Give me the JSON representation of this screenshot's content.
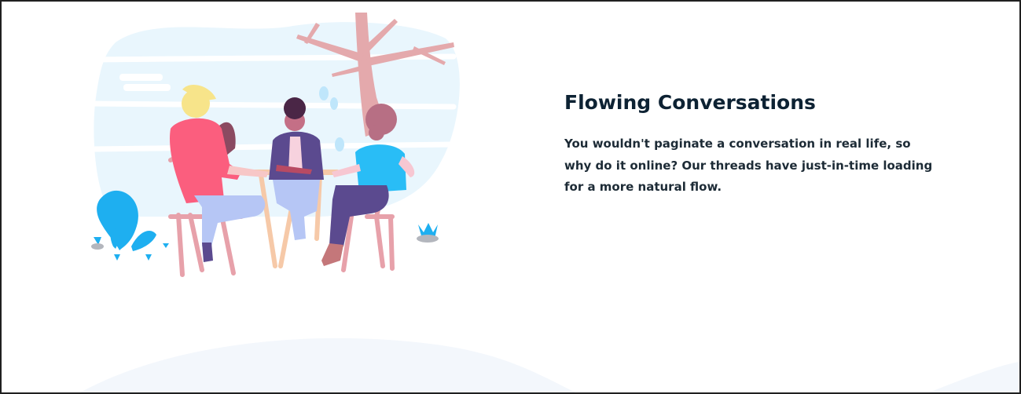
{
  "feature": {
    "title": "Flowing Conversations",
    "description": "You wouldn't paginate a conversation in real life, so why do it online? Our threads have just-in-time loading for a more natural flow."
  },
  "illustration": {
    "name": "friends-at-table-illustration",
    "colors": {
      "sky": "#e9f6fd",
      "tree": "#e4a9ac",
      "plant": "#1eaff0",
      "table": "#f6c9a8",
      "chair": "#e7a1aa",
      "person_pink_shirt": "#fb5e7e",
      "person_purple_jacket": "#5b4a8f",
      "person_blue_shirt": "#29bdf6"
    }
  },
  "theme": {
    "title_color": "#0d2233",
    "text_color": "#1d2b36",
    "wave_color": "#f3f7fc",
    "border_color": "#202020"
  }
}
